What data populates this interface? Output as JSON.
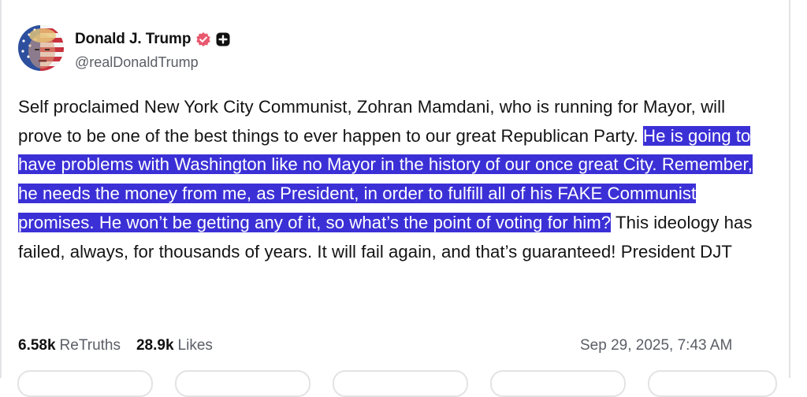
{
  "author": {
    "display_name": "Donald J. Trump",
    "handle": "@realDonaldTrump",
    "verified_icon": "verified-badge-icon",
    "plus_icon": "plus-icon",
    "badge_color": "#e8596e"
  },
  "post": {
    "text_before": "Self proclaimed New York City Communist, Zohran Mamdani, who is running for Mayor, will prove to be one of the best things to ever happen to our great Republican Party. ",
    "text_highlighted": "He is going to have problems with Washington like no Mayor in the history of our once great City. Remember, he needs the money from me, as President, in order to fulfill all of his FAKE Communist promises. He won’t be getting any of it, so what’s the point of voting for him?",
    "text_after": " This ideology has failed, always, for thousands of years. It will fail again, and that’s guaranteed!  President DJT",
    "highlight_color": "#3b30d6"
  },
  "stats": {
    "retruths_count": "6.58k",
    "retruths_label": "ReTruths",
    "likes_count": "28.9k",
    "likes_label": "Likes"
  },
  "timestamp": "Sep 29, 2025, 7:43 AM"
}
